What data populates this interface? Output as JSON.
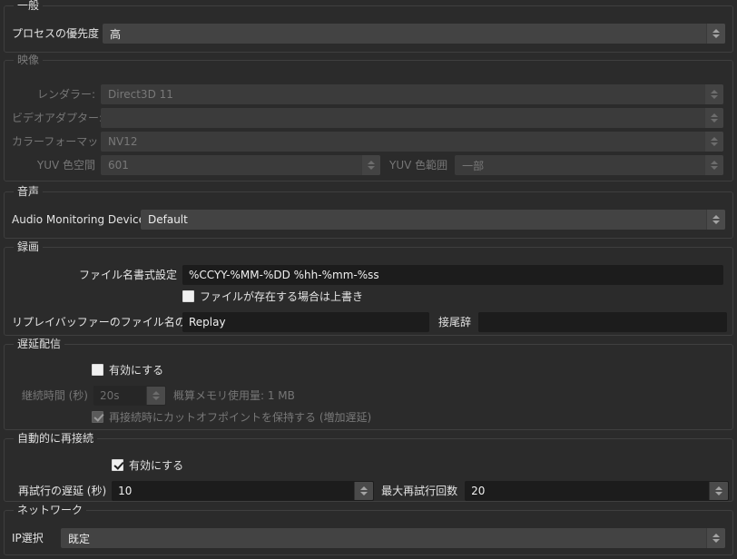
{
  "theme": {
    "window_bg": "#2b2b2b",
    "group_border": "#3f3f3f",
    "combo_bg": "#434343",
    "input_bg": "#1c1c1c",
    "text": "#e6e6e6",
    "text_disabled": "#787878"
  },
  "groups": {
    "general": {
      "title": "一般",
      "process_priority": {
        "label": "プロセスの優先度",
        "value": "高"
      }
    },
    "video": {
      "title": "映像",
      "renderer": {
        "label": "レンダラー:",
        "value": "Direct3D 11"
      },
      "video_adapter": {
        "label": "ビデオアダプター:",
        "value": ""
      },
      "color_format": {
        "label": "カラーフォーマット",
        "value": "NV12"
      },
      "yuv_color_space": {
        "label": "YUV 色空間",
        "value": "601"
      },
      "yuv_color_range": {
        "label": "YUV 色範囲",
        "value": "一部"
      }
    },
    "audio": {
      "title": "音声",
      "monitoring_device": {
        "label": "Audio Monitoring Device",
        "value": "Default"
      }
    },
    "recording": {
      "title": "録画",
      "filename_format": {
        "label": "ファイル名書式設定",
        "value": "%CCYY-%MM-%DD %hh-%mm-%ss"
      },
      "overwrite": {
        "label": "ファイルが存在する場合は上書き",
        "checked": false
      },
      "replay_prefix": {
        "label": "リプレイバッファーのファイル名の接頭辞",
        "value": "Replay"
      },
      "replay_suffix": {
        "label": "接尾辞",
        "value": ""
      }
    },
    "delay": {
      "title": "遅延配信",
      "enable": {
        "label": "有効にする",
        "checked": false
      },
      "duration": {
        "label": "継続時間 (秒)",
        "value": "20s"
      },
      "memory_estimate": "概算メモリ使用量: 1 MB",
      "preserve_cutoff": {
        "label": "再接続時にカットオフポイントを保持する (増加遅延)",
        "checked": true
      }
    },
    "reconnect": {
      "title": "自動的に再接続",
      "enable": {
        "label": "有効にする",
        "checked": true
      },
      "retry_delay": {
        "label": "再試行の遅延 (秒)",
        "value": "10"
      },
      "max_retries": {
        "label": "最大再試行回数",
        "value": "20"
      }
    },
    "network": {
      "title": "ネットワーク",
      "ip_select": {
        "label": "IP選択",
        "value": "既定"
      }
    }
  },
  "icons": {
    "spinner_up": "chevron-up-icon",
    "spinner_down": "chevron-down-icon"
  }
}
